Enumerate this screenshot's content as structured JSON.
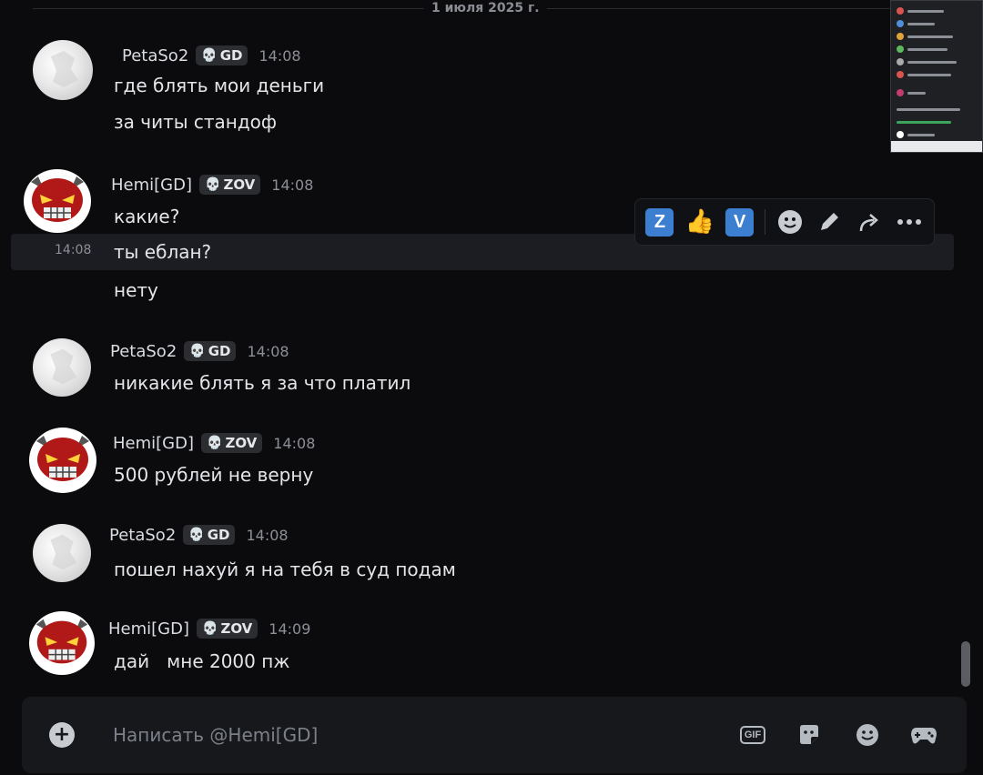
{
  "date_divider": "1 июля 2025 г.",
  "messages": [
    {
      "author": "PetaSo2",
      "tag": "GD",
      "time": "14:08",
      "lines": [
        "где блять мои деньги",
        "за читы стандоф"
      ]
    },
    {
      "author": "Hemi[GD]",
      "tag": "ZOV",
      "time": "14:08",
      "lines": [
        "какие?",
        "ты еблан?",
        "нету"
      ],
      "hover_time": "14:08"
    },
    {
      "author": "PetaSo2",
      "tag": "GD",
      "time": "14:08",
      "lines": [
        "никакие блять я за что платил"
      ]
    },
    {
      "author": "Hemi[GD]",
      "tag": "ZOV",
      "time": "14:08",
      "lines": [
        "500 рублей не верну"
      ]
    },
    {
      "author": "PetaSo2",
      "tag": "GD",
      "time": "14:08",
      "lines": [
        "пошел нахуй я на тебя в суд подам"
      ]
    },
    {
      "author": "Hemi[GD]",
      "tag": "ZOV",
      "time": "14:09",
      "lines": [
        "дай   мне 2000 пж"
      ]
    }
  ],
  "toolbar": {
    "reaction_1": "Z",
    "reaction_2": "thumbs-up",
    "reaction_3": "V",
    "icons": [
      "add-reaction-icon",
      "edit-icon",
      "forward-icon",
      "more-icon"
    ]
  },
  "composer": {
    "placeholder": "Написать @Hemi[GD]",
    "gif_label": "GIF",
    "icons": [
      "plus-icon",
      "gif-icon",
      "sticker-icon",
      "emoji-icon",
      "gamepad-icon"
    ]
  },
  "colors": {
    "background": "#0b0b0d",
    "hover_row": "#1c1d22",
    "tag_bg": "#2b2d31",
    "emoji_blue": "#3c7fd1"
  }
}
